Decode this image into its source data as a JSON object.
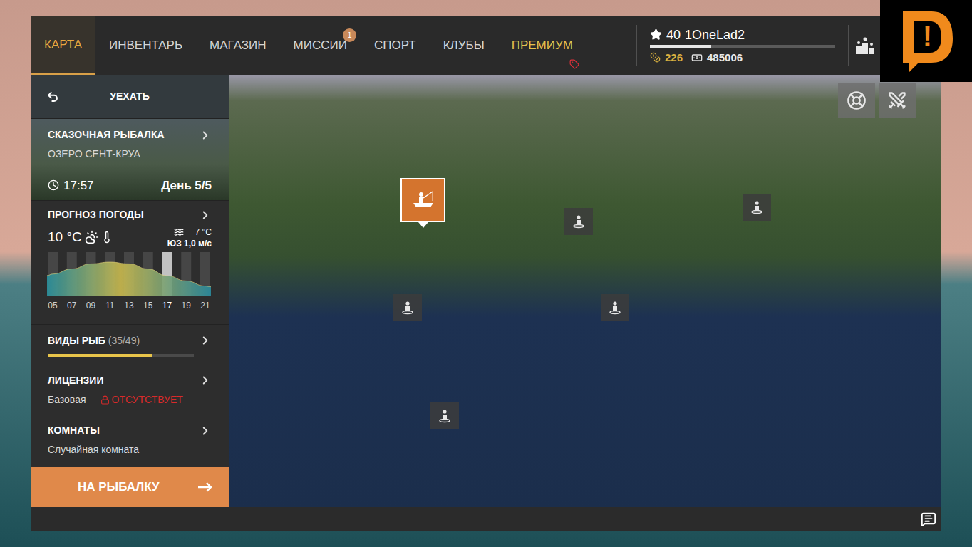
{
  "nav": {
    "tabs": [
      {
        "label": "КАРТА",
        "selected": true,
        "kind": "normal"
      },
      {
        "label": "ИНВЕНТАРЬ",
        "selected": false,
        "kind": "normal"
      },
      {
        "label": "МАГАЗИН",
        "selected": false,
        "kind": "normal"
      },
      {
        "label": "МИССИИ",
        "selected": false,
        "kind": "normal",
        "badge": "1"
      },
      {
        "label": "СПОРТ",
        "selected": false,
        "kind": "normal"
      },
      {
        "label": "КЛУБЫ",
        "selected": false,
        "kind": "normal"
      },
      {
        "label": "ПРЕМИУМ",
        "selected": false,
        "kind": "premium"
      }
    ]
  },
  "player": {
    "rank": "40",
    "name": "1OneLad2",
    "xp_level": 0.33,
    "gold": "226",
    "silver": "485006"
  },
  "sidebar": {
    "back": "УЕХАТЬ",
    "location": {
      "title": "СКАЗОЧНАЯ РЫБАЛКА",
      "lake": "ОЗЕРО СЕНТ-КРУА",
      "time": "17:57",
      "day": "День 5/5"
    },
    "weather": {
      "title": "ПРОГНОЗ ПОГОДЫ",
      "air_temp": "10 °C",
      "water_temp": "7 °C",
      "wind": "ЮЗ 1,0 м/с",
      "chart": {
        "hours": [
          {
            "label": "05",
            "selected": false
          },
          {
            "label": "07",
            "selected": false
          },
          {
            "label": "09",
            "selected": false
          },
          {
            "label": "11",
            "selected": false
          },
          {
            "label": "13",
            "selected": false
          },
          {
            "label": "15",
            "selected": false
          },
          {
            "label": "17",
            "selected": true
          },
          {
            "label": "19",
            "selected": false
          },
          {
            "label": "21",
            "selected": false
          }
        ],
        "temperature": [
          6.5,
          8,
          9.5,
          10,
          9.5,
          8,
          6,
          4.5,
          3
        ]
      }
    },
    "fish": {
      "title": "ВИДЫ РЫБ",
      "count": "(35/49)",
      "level": 0.71
    },
    "licenses": {
      "title": "ЛИЦЕНЗИИ",
      "type": "Базовая",
      "status": "ОТСУТСТВУЕТ"
    },
    "rooms": {
      "title": "КОМНАТЫ",
      "value": "Случайная комната"
    },
    "action": "НА РЫБАЛКУ"
  },
  "map": {
    "pins": [
      {
        "kind": "boat",
        "selected": true
      },
      {
        "kind": "spot",
        "selected": false
      },
      {
        "kind": "spot",
        "selected": false
      },
      {
        "kind": "spot",
        "selected": false
      },
      {
        "kind": "spot",
        "selected": false
      },
      {
        "kind": "spot",
        "selected": false
      }
    ]
  },
  "logo": {
    "mark": "!"
  }
}
